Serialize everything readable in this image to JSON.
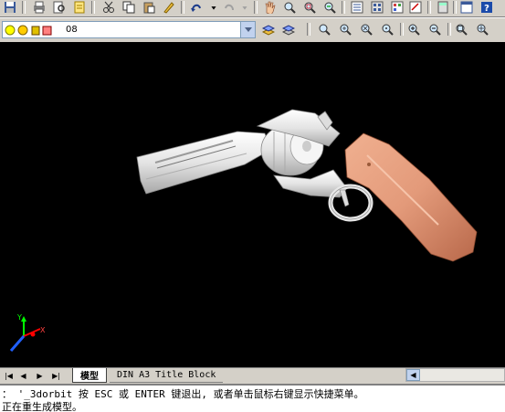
{
  "toolbar": {
    "icons": [
      "save-icon",
      "print-icon",
      "preview-icon",
      "publish-icon",
      "cut-icon",
      "copy-icon",
      "paste-icon",
      "match-properties-icon",
      "undo-icon",
      "redo-icon",
      "pan-icon",
      "zoom-realtime-icon",
      "zoom-window-icon",
      "zoom-previous-icon",
      "properties-icon",
      "design-center-icon",
      "tool-palette-icon",
      "help-icon"
    ]
  },
  "layer": {
    "current_layer": "08",
    "colors": {
      "lightbulb": "#ffff00",
      "sun": "#ffcc00",
      "color_swatch": "#ff8080"
    }
  },
  "viewport": {
    "background": "#000000",
    "ucs": {
      "x_label": "X",
      "y_label": "Y"
    }
  },
  "tabs": {
    "model": "模型",
    "layout": "DIN A3 Title Block"
  },
  "command": {
    "line1": "： '_3dorbit 按 ESC 或 ENTER 键退出, 或者单击鼠标右键显示快捷菜单。",
    "line2": "正在重生成模型。"
  },
  "colors": {
    "toolbar_bg": "#d4d0c8",
    "grip": "#e39a7a",
    "metal": "#e8e8e8"
  }
}
